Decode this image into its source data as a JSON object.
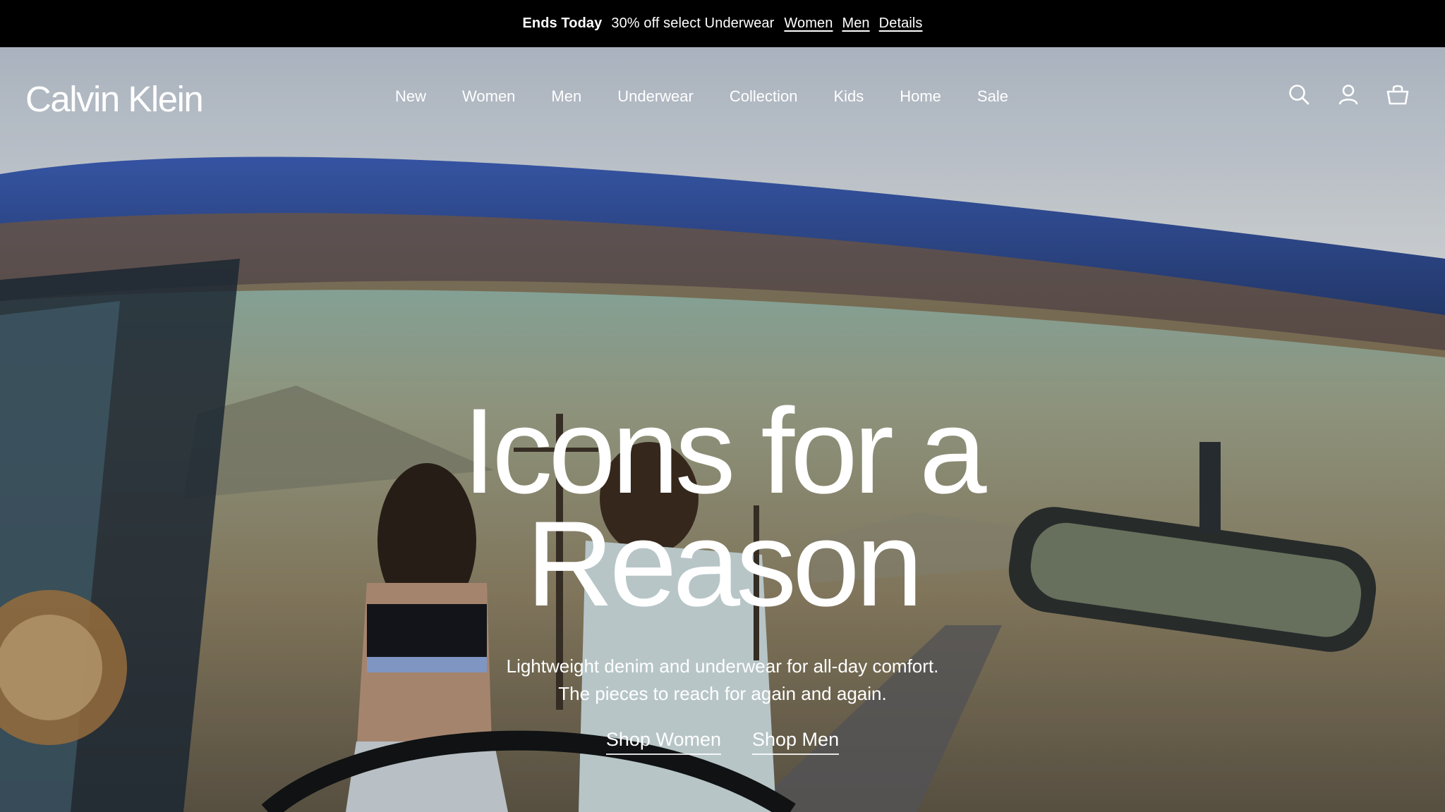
{
  "promo": {
    "ends": "Ends Today",
    "offer": "30% off select Underwear",
    "links": [
      "Women",
      "Men",
      "Details"
    ]
  },
  "header": {
    "logo": "Calvin Klein",
    "nav": [
      "New",
      "Women",
      "Men",
      "Underwear",
      "Collection",
      "Kids",
      "Home",
      "Sale"
    ],
    "icons": [
      "search-icon",
      "account-icon",
      "bag-icon"
    ]
  },
  "hero": {
    "title_line1": "Icons for a",
    "title_line2": "Reason",
    "subtitle_line1": "Lightweight denim and underwear for all-day comfort.",
    "subtitle_line2": "The pieces to reach for again and again.",
    "cta_women": "Shop Women",
    "cta_men": "Shop Men"
  },
  "colors": {
    "promo_bg": "#000000",
    "text": "#ffffff",
    "car_blue": "#2f4a8a"
  }
}
